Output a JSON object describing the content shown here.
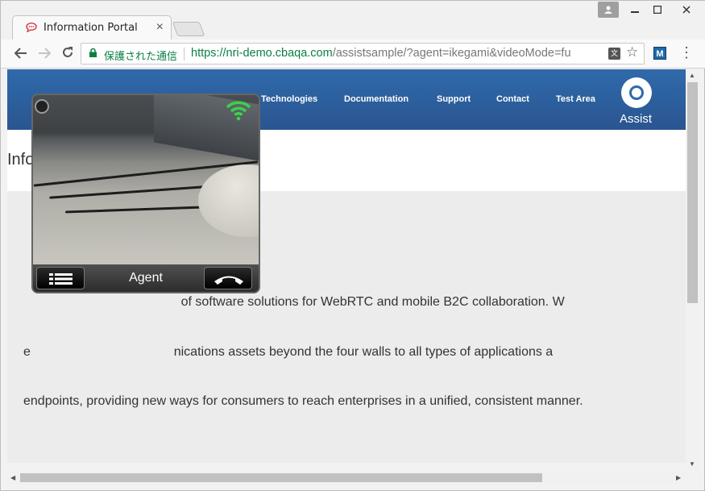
{
  "browser": {
    "tab_title": "Information Portal",
    "tab_close": "×",
    "secure_label": "保護された通信",
    "url_scheme": "https://",
    "url_host": "nri-demo.cbaqa.com",
    "url_path": "/assistsample/?agent=ikegami&videoMode=fu",
    "extension_label": "M",
    "translate_label": "文"
  },
  "site": {
    "nav": [
      "Technologies",
      "Documentation",
      "Support",
      "Contact",
      "Test Area"
    ],
    "assist_label": "Assist",
    "hero_title": "Info",
    "body_lines": [
      "                                            of software solutions for WebRTC and mobile B2C collaboration. W",
      "e                                        nications assets beyond the four walls to all types of applications a",
      "endpoints, providing new ways for consumers to reach enterprises in a unified, consistent manner."
    ]
  },
  "video": {
    "agent_label": "Agent"
  }
}
